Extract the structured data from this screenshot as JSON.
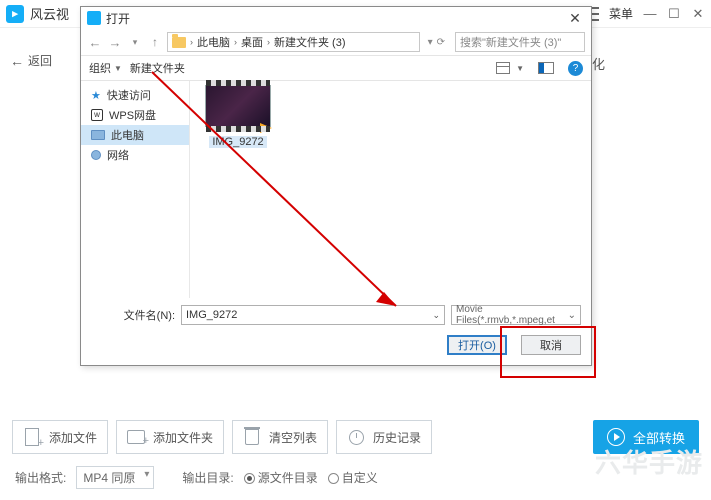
{
  "app": {
    "title": "风云视",
    "menu_label": "菜单"
  },
  "back_label": "返回",
  "trailing": "化",
  "dialog": {
    "title": "打开",
    "breadcrumb": {
      "b1": "此电脑",
      "b2": "桌面",
      "b3": "新建文件夹 (3)"
    },
    "search_placeholder": "搜索\"新建文件夹 (3)\"",
    "toolbar": {
      "organize": "组织",
      "new_folder": "新建文件夹"
    },
    "sidebar": {
      "quick": "快速访问",
      "wps": "WPS网盘",
      "pc": "此电脑",
      "network": "网络"
    },
    "file": {
      "name": "IMG_9272"
    },
    "fn_label": "文件名(N):",
    "fn_value": "IMG_9272",
    "filter": "Movie Files(*.rmvb,*.mpeg,et",
    "open_btn": "打开(O)",
    "cancel_btn": "取消"
  },
  "bottom": {
    "add_file": "添加文件",
    "add_folder": "添加文件夹",
    "clear_list": "清空列表",
    "history": "历史记录",
    "convert_all": "全部转换"
  },
  "format_row": {
    "out_format_label": "输出格式:",
    "format_value": "MP4 同原",
    "out_dir_label": "输出目录:",
    "opt_source": "源文件目录",
    "opt_custom": "自定义"
  },
  "watermark": "六华手游"
}
